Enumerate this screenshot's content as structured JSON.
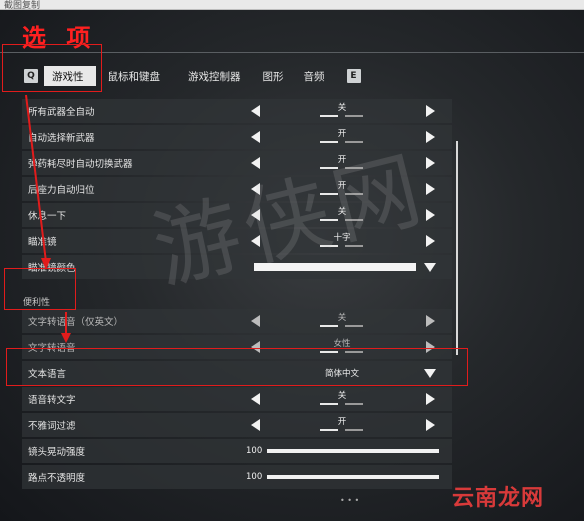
{
  "window": {
    "title": "截图复制"
  },
  "page": {
    "title": "选 项"
  },
  "tabs": {
    "left_key": "Q",
    "right_key": "E",
    "items": [
      {
        "label": "游戏性",
        "active": true
      },
      {
        "label": "鼠标和键盘",
        "active": false
      },
      {
        "label": "游戏控制器",
        "active": false
      },
      {
        "label": "图形",
        "active": false
      },
      {
        "label": "音频",
        "active": false
      }
    ]
  },
  "settings": {
    "rows": [
      {
        "label": "所有武器全自动",
        "value": "关"
      },
      {
        "label": "自动选择新武器",
        "value": "开"
      },
      {
        "label": "弹药耗尽时自动切换武器",
        "value": "开"
      },
      {
        "label": "后座力自动归位",
        "value": "开"
      },
      {
        "label": "休息一下",
        "value": "关"
      },
      {
        "label": "瞄准镜",
        "value": "十字"
      },
      {
        "label": "瞄准镜颜色",
        "value": ""
      }
    ],
    "section_label": "便利性",
    "accessibility_rows": [
      {
        "label": "文字转语音（仅英文）",
        "value": "关"
      },
      {
        "label": "文字转语音",
        "value": "女性"
      },
      {
        "label": "文本语言",
        "value": "简体中文"
      },
      {
        "label": "语音转文字",
        "value": "关"
      },
      {
        "label": "不雅词过滤",
        "value": "开"
      },
      {
        "label": "镜头晃动强度",
        "value": "100",
        "level": 1.0
      },
      {
        "label": "路点不透明度",
        "value": "100",
        "level": 1.0
      }
    ]
  },
  "watermark": {
    "text": "游侠网"
  },
  "brand": {
    "text": "云南龙网"
  },
  "colors": {
    "accent_red": "#e11c1c",
    "tab_active_bg": "#e8e8e8",
    "row_bg": "#303438"
  },
  "icons": [
    "left-arrow-icon",
    "right-arrow-icon",
    "dropdown-caret-icon"
  ]
}
